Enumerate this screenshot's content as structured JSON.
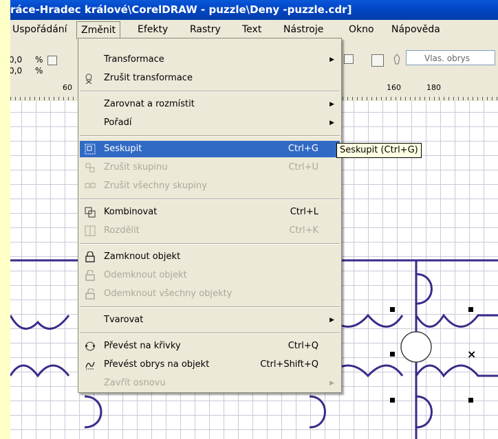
{
  "window": {
    "title": "ráce-Hradec králové\\CorelDRAW - puzzle\\Deny -puzzle.cdr]"
  },
  "menubar": {
    "items": [
      {
        "label": "Uspořádání"
      },
      {
        "label": "Změnit"
      },
      {
        "label": "Efekty"
      },
      {
        "label": "Rastry"
      },
      {
        "label": "Text"
      },
      {
        "label": "Nástroje"
      },
      {
        "label": "Okno"
      },
      {
        "label": "Nápověda"
      }
    ],
    "active": "Změnit"
  },
  "toolbar": {
    "scale_x": "0,0",
    "scale_y": "0,0",
    "percent": "%",
    "outline_placeholder": "Vlas. obrys"
  },
  "ruler": {
    "labels": [
      "60",
      "160",
      "180"
    ]
  },
  "dropdown": {
    "items": [
      {
        "label": "Transformace",
        "shortcut": "",
        "submenu": true,
        "disabled": false,
        "icon": ""
      },
      {
        "label": "Zrušit transformace",
        "shortcut": "",
        "submenu": false,
        "disabled": false,
        "icon": "clear-transform-icon"
      },
      {
        "label": "Zarovnat a rozmístit",
        "shortcut": "",
        "submenu": true,
        "disabled": false,
        "icon": ""
      },
      {
        "label": "Pořadí",
        "shortcut": "",
        "submenu": true,
        "disabled": false,
        "icon": ""
      },
      {
        "label": "Seskupit",
        "shortcut": "Ctrl+G",
        "submenu": false,
        "disabled": false,
        "icon": "group-icon",
        "highlight": true
      },
      {
        "label": "Zrušit skupinu",
        "shortcut": "Ctrl+U",
        "submenu": false,
        "disabled": true,
        "icon": "ungroup-icon"
      },
      {
        "label": "Zrušit všechny skupiny",
        "shortcut": "",
        "submenu": false,
        "disabled": true,
        "icon": "ungroup-all-icon"
      },
      {
        "label": "Kombinovat",
        "shortcut": "Ctrl+L",
        "submenu": false,
        "disabled": false,
        "icon": "combine-icon"
      },
      {
        "label": "Rozdělit",
        "shortcut": "Ctrl+K",
        "submenu": false,
        "disabled": true,
        "icon": "break-apart-icon"
      },
      {
        "label": "Zamknout objekt",
        "shortcut": "",
        "submenu": false,
        "disabled": false,
        "icon": "lock-icon"
      },
      {
        "label": "Odemknout objekt",
        "shortcut": "",
        "submenu": false,
        "disabled": true,
        "icon": "unlock-icon"
      },
      {
        "label": "Odemknout všechny objekty",
        "shortcut": "",
        "submenu": false,
        "disabled": true,
        "icon": "unlock-all-icon"
      },
      {
        "label": "Tvarovat",
        "shortcut": "",
        "submenu": true,
        "disabled": false,
        "icon": ""
      },
      {
        "label": "Převést na křivky",
        "shortcut": "Ctrl+Q",
        "submenu": false,
        "disabled": false,
        "icon": "convert-to-curves-icon"
      },
      {
        "label": "Převést obrys na objekt",
        "shortcut": "Ctrl+Shift+Q",
        "submenu": false,
        "disabled": false,
        "icon": "outline-to-object-icon"
      },
      {
        "label": "Zavřít osnovu",
        "shortcut": "",
        "submenu": true,
        "disabled": true,
        "icon": ""
      }
    ]
  },
  "tooltip": {
    "text": "Seskupit (Ctrl+G)"
  },
  "colors": {
    "menu_bg": "#ece9d8",
    "highlight": "#316ac5",
    "disabled_text": "#aca899",
    "puzzle_line": "#3b2a8a",
    "page_border": "#ffffc8"
  }
}
